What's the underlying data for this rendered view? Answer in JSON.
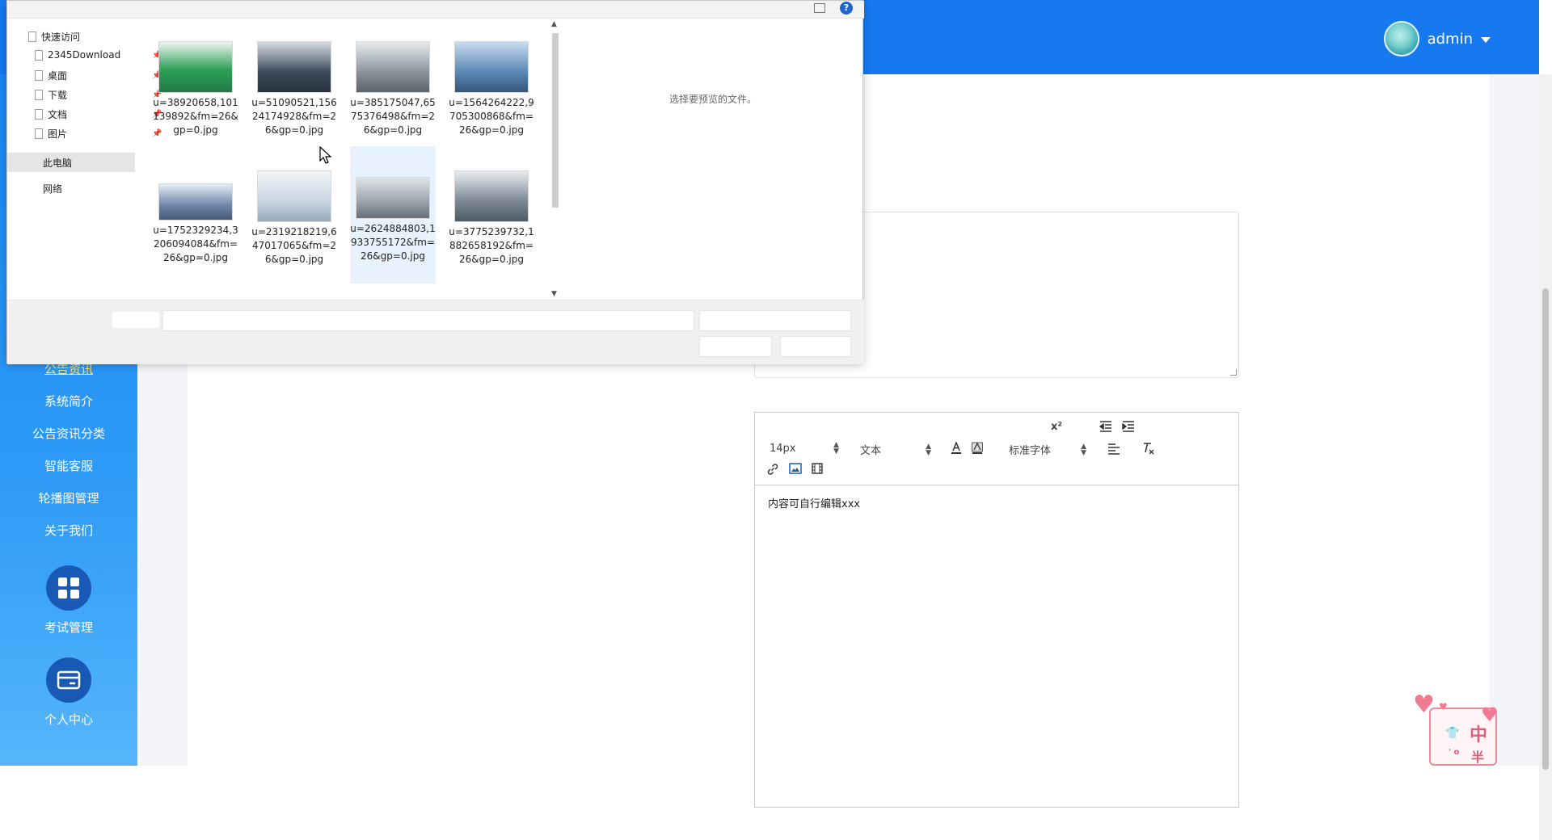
{
  "header": {
    "user": {
      "name": "admin",
      "avatar_icon": "avatar-image"
    }
  },
  "sidebar": {
    "items": [
      {
        "label": "公告资讯",
        "active": true
      },
      {
        "label": "系统简介"
      },
      {
        "label": "公告资讯分类"
      },
      {
        "label": "智能客服"
      },
      {
        "label": "轮播图管理"
      },
      {
        "label": "关于我们"
      }
    ],
    "modules": [
      {
        "label": "考试管理",
        "icon": "grid-icon"
      },
      {
        "label": "个人中心",
        "icon": "card-icon"
      }
    ]
  },
  "editor": {
    "font_size": "14px",
    "block_format": "文本",
    "font_family": "标准字体",
    "superscript": "x²",
    "content": "内容可自行编辑xxx"
  },
  "dialog": {
    "nav": {
      "quick_access": "快速访问",
      "pinned": [
        "2345Download",
        "桌面",
        "下载",
        "文档",
        "图片"
      ],
      "this_pc": "此电脑",
      "network": "网络"
    },
    "files": [
      {
        "name": "u=38920658,101139892&fm=26&gp=0.jpg",
        "color": "#2fa05a"
      },
      {
        "name": "u=51090521,15624174928&fm=26&gp=0.jpg",
        "color": "#3d4a5a"
      },
      {
        "name": "u=385175047,6575376498&fm=26&gp=0.jpg",
        "color": "#8a939c"
      },
      {
        "name": "u=1564264222,9705300868&fm=26&gp=0.jpg",
        "color": "#5b88b6"
      },
      {
        "name": "u=1752329234,3206094084&fm=26&gp=0.jpg",
        "color": "#6f86a8"
      },
      {
        "name": "u=2319218219,647017065&fm=26&gp=0.jpg",
        "color": "#c9d6e3"
      },
      {
        "name": "u=2624884803,1933755172&fm=26&gp=0.jpg",
        "color": "#9aa2ab"
      },
      {
        "name": "u=3775239732,1882658192&fm=26&gp=0.jpg",
        "color": "#7b8793"
      }
    ],
    "preview_text": "选择要预览的文件。"
  },
  "stamp": {
    "char1": "中",
    "char2": "半",
    "small": "' o"
  }
}
